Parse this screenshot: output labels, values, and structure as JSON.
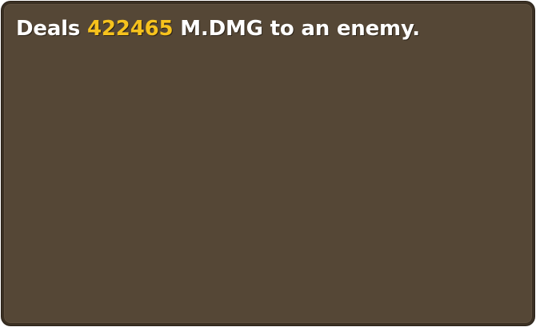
{
  "tooltip": {
    "description": {
      "prefix": "Deals ",
      "damage_value": "422465",
      "suffix": " M.DMG to an enemy."
    }
  },
  "colors": {
    "panel_background": "#554736",
    "panel_border": "#3b3023",
    "text": "#ffffff",
    "highlight_value": "#f6c21d"
  }
}
